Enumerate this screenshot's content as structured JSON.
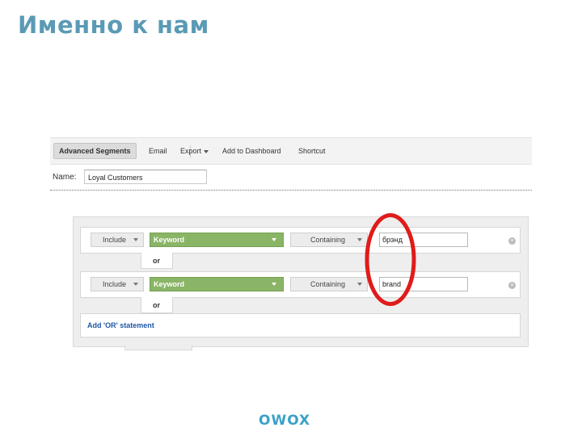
{
  "slide": {
    "title": "Именно к нам"
  },
  "toolbar": {
    "items": [
      "Advanced Segments",
      "Email",
      "Export",
      "Add to Dashboard",
      "Shortcut"
    ]
  },
  "name_field": {
    "label": "Name:",
    "value": "Loyal Customers"
  },
  "conditions": [
    {
      "include": "Include",
      "dimension": "Keyword",
      "match": "Containing",
      "value": "брэнд"
    },
    {
      "include": "Include",
      "dimension": "Keyword",
      "match": "Containing",
      "value": "brand"
    }
  ],
  "or_labels": [
    "or",
    "or"
  ],
  "add_or": "Add 'OR' statement",
  "highlight_color": "#e01b1b",
  "logo": {
    "text": "OWOX",
    "color": "#3aa0c8"
  }
}
